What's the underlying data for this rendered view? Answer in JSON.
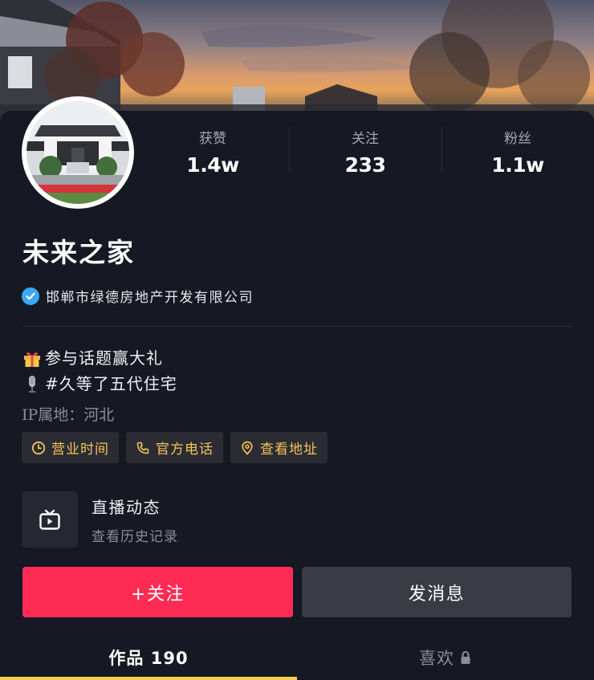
{
  "profile": {
    "name": "未来之家",
    "verified": true,
    "verification_text": "邯郸市绿德房地产开发有限公司",
    "ip_location": "IP属地：河北"
  },
  "stats": [
    {
      "label": "获赞",
      "value": "1.4w"
    },
    {
      "label": "关注",
      "value": "233"
    },
    {
      "label": "粉丝",
      "value": "1.1w"
    }
  ],
  "bio": [
    {
      "icon": "gift-icon",
      "text": "参与话题赢大礼"
    },
    {
      "icon": "microphone-icon",
      "text": "#久等了五代住宅"
    }
  ],
  "chips": [
    {
      "icon": "clock-icon",
      "label": "营业时间"
    },
    {
      "icon": "phone-icon",
      "label": "官方电话"
    },
    {
      "icon": "location-pin-icon",
      "label": "查看地址"
    }
  ],
  "live": {
    "icon": "tv-icon",
    "title": "直播动态",
    "subtitle": "查看历史记录"
  },
  "actions": {
    "follow_label": "+关注",
    "message_label": "发消息"
  },
  "tabs": {
    "works_label": "作品 190",
    "likes_label": "喜欢",
    "likes_icon": "lock-icon"
  },
  "colors": {
    "background": "#161823",
    "accent_follow": "#fe2c55",
    "chip_text": "#f4c25a",
    "tab_indicator": "#f8ce4c",
    "verify_badge": "#3ba7f5"
  }
}
